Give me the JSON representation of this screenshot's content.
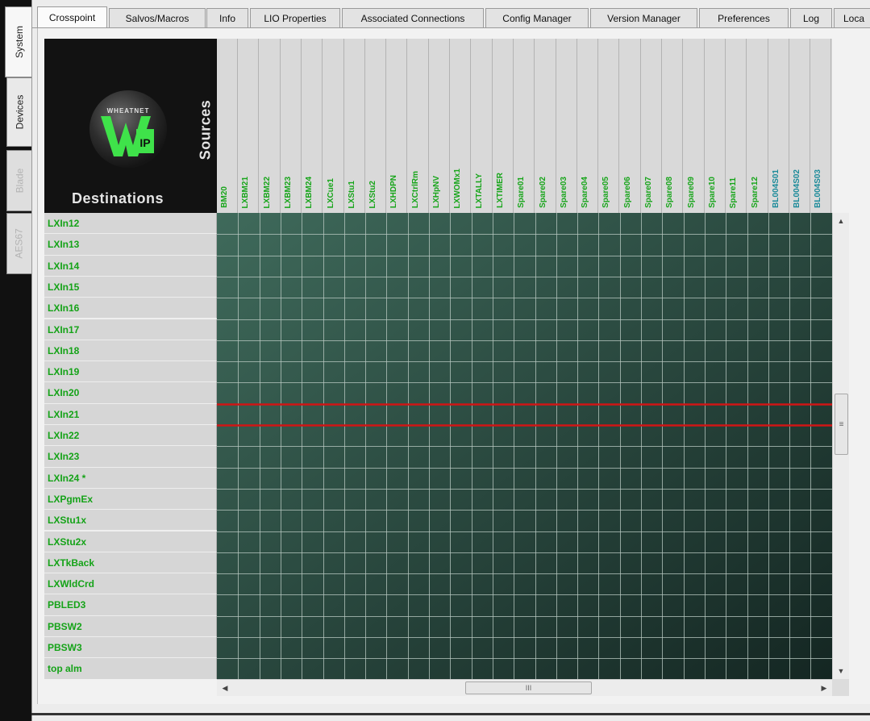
{
  "vertical_tabs": [
    {
      "label": "System",
      "state": "active"
    },
    {
      "label": "Devices",
      "state": "normal"
    },
    {
      "label": "Blade",
      "state": "disabled"
    },
    {
      "label": "AES67",
      "state": "disabled"
    }
  ],
  "top_tabs": [
    {
      "label": "Crosspoint",
      "active": true
    },
    {
      "label": "Salvos/Macros",
      "active": false
    },
    {
      "label": "Info",
      "active": false
    },
    {
      "label": "LIO Properties",
      "active": false
    },
    {
      "label": "Associated Connections",
      "active": false
    },
    {
      "label": "Config Manager",
      "active": false
    },
    {
      "label": "Version Manager",
      "active": false
    },
    {
      "label": "Preferences",
      "active": false
    },
    {
      "label": "Log",
      "active": false
    },
    {
      "label": "Loca",
      "active": false
    }
  ],
  "corner": {
    "logo_text": "WHEATNET",
    "logo_mark": "IP",
    "destinations_label": "Destinations",
    "sources_label": "Sources"
  },
  "sources": [
    {
      "name": "BM20",
      "style": "green"
    },
    {
      "name": "LXBM21",
      "style": "green"
    },
    {
      "name": "LXBM22",
      "style": "green"
    },
    {
      "name": "LXBM23",
      "style": "green"
    },
    {
      "name": "LXBM24",
      "style": "green"
    },
    {
      "name": "LXCue1",
      "style": "green"
    },
    {
      "name": "LXStu1",
      "style": "green"
    },
    {
      "name": "LXStu2",
      "style": "green"
    },
    {
      "name": "LXHDPN",
      "style": "green"
    },
    {
      "name": "LXCtrlRm",
      "style": "green"
    },
    {
      "name": "LXHpNV",
      "style": "green"
    },
    {
      "name": "LXWOMx1",
      "style": "green"
    },
    {
      "name": "LXTALLY",
      "style": "green"
    },
    {
      "name": "LXTIMER",
      "style": "green"
    },
    {
      "name": "Spare01",
      "style": "green"
    },
    {
      "name": "Spare02",
      "style": "green"
    },
    {
      "name": "Spare03",
      "style": "green"
    },
    {
      "name": "Spare04",
      "style": "green"
    },
    {
      "name": "Spare05",
      "style": "green"
    },
    {
      "name": "Spare06",
      "style": "green"
    },
    {
      "name": "Spare07",
      "style": "green"
    },
    {
      "name": "Spare08",
      "style": "green"
    },
    {
      "name": "Spare09",
      "style": "green"
    },
    {
      "name": "Spare10",
      "style": "green"
    },
    {
      "name": "Spare11",
      "style": "green"
    },
    {
      "name": "Spare12",
      "style": "green"
    },
    {
      "name": "BL004S01",
      "style": "teal"
    },
    {
      "name": "BL004S02",
      "style": "teal"
    },
    {
      "name": "BL004S03",
      "style": "teal"
    }
  ],
  "destinations": [
    {
      "name": "LXIn12",
      "highlighted": false
    },
    {
      "name": "LXIn13",
      "highlighted": false
    },
    {
      "name": "LXIn14",
      "highlighted": false
    },
    {
      "name": "LXIn15",
      "highlighted": false
    },
    {
      "name": "LXIn16",
      "highlighted": false
    },
    {
      "name": "LXIn17",
      "highlighted": false
    },
    {
      "name": "LXIn18",
      "highlighted": false
    },
    {
      "name": "LXIn19",
      "highlighted": false
    },
    {
      "name": "LXIn20",
      "highlighted": false
    },
    {
      "name": "LXIn21",
      "highlighted": true
    },
    {
      "name": "LXIn22",
      "highlighted": false
    },
    {
      "name": "LXIn23",
      "highlighted": false
    },
    {
      "name": "LXIn24 *",
      "highlighted": false
    },
    {
      "name": "LXPgmEx",
      "highlighted": false
    },
    {
      "name": "LXStu1x",
      "highlighted": false
    },
    {
      "name": "LXStu2x",
      "highlighted": false
    },
    {
      "name": "LXTkBack",
      "highlighted": false
    },
    {
      "name": "LXWldCrd",
      "highlighted": false
    },
    {
      "name": "PBLED3",
      "highlighted": false
    },
    {
      "name": "PBSW2",
      "highlighted": false
    },
    {
      "name": "PBSW3",
      "highlighted": false
    },
    {
      "name": "top alm",
      "highlighted": false
    }
  ],
  "scrollbars": {
    "vertical_thumb_glyph": "≡",
    "horizontal_thumb_glyph": "III",
    "up_arrow": "▲",
    "down_arrow": "▼",
    "left_arrow": "◀",
    "right_arrow": "▶"
  },
  "colors": {
    "grid_fill_top": "#3f6a5b",
    "grid_fill_bottom": "#142622",
    "grid_lines": "#b9c9c2",
    "highlight_line": "#d01515",
    "label_green": "#15a318",
    "label_teal": "#1c8b9a"
  }
}
